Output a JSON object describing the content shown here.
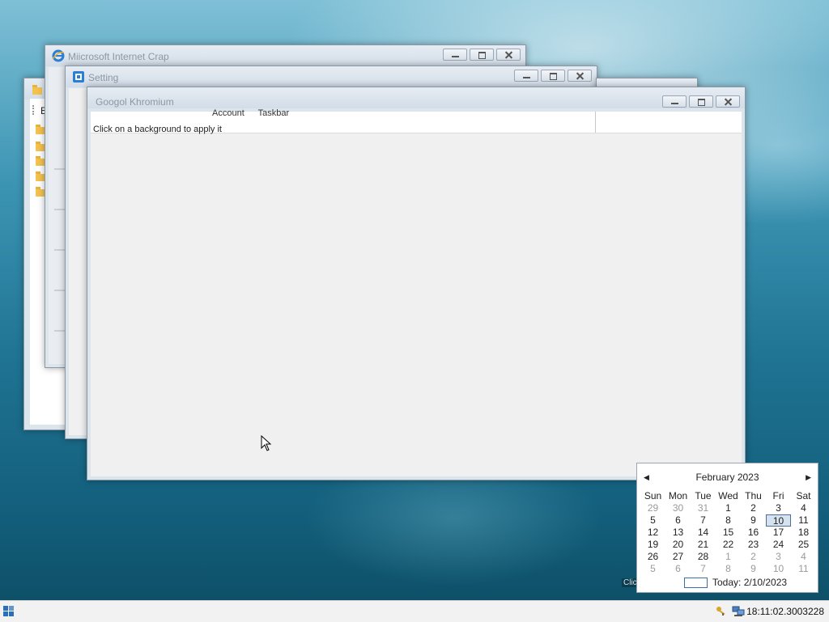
{
  "windows": {
    "explorer": {
      "partial_label": "E"
    },
    "ie": {
      "title": "Miicrosoft Internet Crap"
    },
    "setting": {
      "title": "Setting"
    },
    "chromium": {
      "title": "Googol Khromium",
      "tab_labels": [
        "Account",
        "Taskbar"
      ],
      "hint": "Click on a background to apply it"
    }
  },
  "calendar": {
    "month_label": "February 2023",
    "days_of_week": [
      "Sun",
      "Mon",
      "Tue",
      "Wed",
      "Thu",
      "Fri",
      "Sat"
    ],
    "weeks": [
      [
        "29",
        "30",
        "31",
        "1",
        "2",
        "3",
        "4"
      ],
      [
        "5",
        "6",
        "7",
        "8",
        "9",
        "10",
        "11"
      ],
      [
        "12",
        "13",
        "14",
        "15",
        "16",
        "17",
        "18"
      ],
      [
        "19",
        "20",
        "21",
        "22",
        "23",
        "24",
        "25"
      ],
      [
        "26",
        "27",
        "28",
        "1",
        "2",
        "3",
        "4"
      ],
      [
        "5",
        "6",
        "7",
        "8",
        "9",
        "10",
        "11"
      ]
    ],
    "selected_day": "10",
    "today_label": "Today: 2/10/2023"
  },
  "overlay_hint": "Clic",
  "taskbar": {
    "clock": "18:11:02.3003228"
  },
  "icons": {
    "ie": "ie-logo-icon",
    "setting": "setting-window-icon",
    "start": "start-logo-icon",
    "tray_key": "key-icon",
    "tray_network": "network-icon",
    "cursor": "mouse-cursor-icon"
  }
}
